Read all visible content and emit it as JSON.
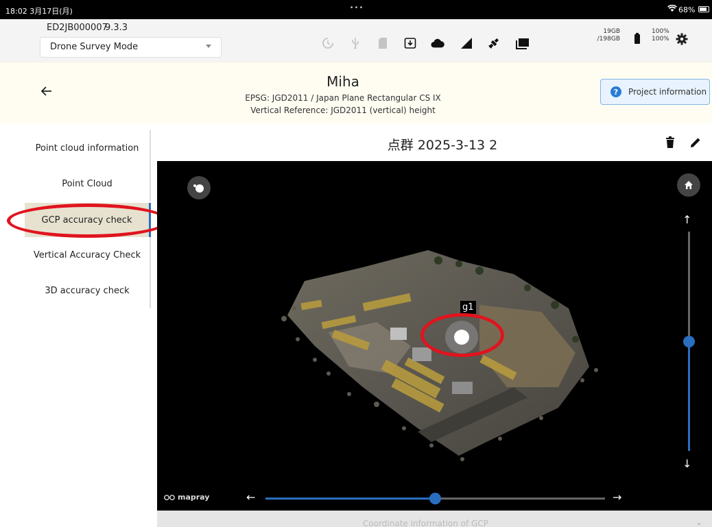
{
  "status_bar": {
    "time": "18:02  3月17日(月)",
    "dots": "•••",
    "battery": "68%"
  },
  "app_bar": {
    "device_id": "ED2JB000007",
    "version": "9.3.3",
    "mode": "Drone Survey Mode",
    "storage_used": "19GB",
    "storage_total": "/198GB",
    "battery_1": "100%",
    "battery_2": "100%",
    "icons": [
      "sync-icon",
      "usb-icon",
      "sd-card-icon",
      "download-icon",
      "cloud-icon",
      "signal-icon",
      "satellite-icon",
      "folder-icon",
      "battery-icon",
      "gear-icon"
    ]
  },
  "project": {
    "title": "Miha",
    "epsg": "EPSG: JGD2011 / Japan Plane Rectangular CS IX",
    "vertical": "Vertical Reference: JGD2011 (vertical) height",
    "info_button": "Project information"
  },
  "sidebar": {
    "items": [
      {
        "label": "Point cloud information"
      },
      {
        "label": "Point Cloud"
      },
      {
        "label": "GCP accuracy check"
      },
      {
        "label": "Vertical Accuracy Check"
      },
      {
        "label": "3D accuracy check"
      }
    ],
    "active_index": 2
  },
  "content": {
    "title": "点群 2025-3-13 2"
  },
  "viewer": {
    "point_label": "g1",
    "logo": "mapray",
    "vertical_slider_level": 0.5,
    "horizontal_slider_level": 0.5
  },
  "bottom_panel": {
    "title": "Coordinate information of GCP"
  },
  "colors": {
    "accent": "#2a6fbf",
    "highlight_oval": "#e0141e",
    "header_bg": "#fffdf2"
  }
}
